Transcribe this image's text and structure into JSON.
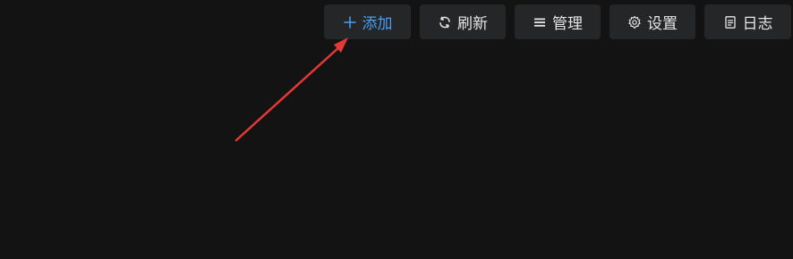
{
  "toolbar": {
    "add": {
      "label": "添加",
      "icon": "plus-icon",
      "color": "#4a9ff2"
    },
    "refresh": {
      "label": "刷新",
      "icon": "refresh-icon"
    },
    "manage": {
      "label": "管理",
      "icon": "list-icon"
    },
    "settings": {
      "label": "设置",
      "icon": "gear-icon"
    },
    "log": {
      "label": "日志",
      "icon": "document-icon"
    }
  },
  "annotation": {
    "icon": "red-arrow-pointer",
    "color": "#e53935"
  },
  "colors": {
    "background": "#131313",
    "button_bg": "#252627",
    "text": "#e6e6e6",
    "accent": "#4a9ff2"
  }
}
